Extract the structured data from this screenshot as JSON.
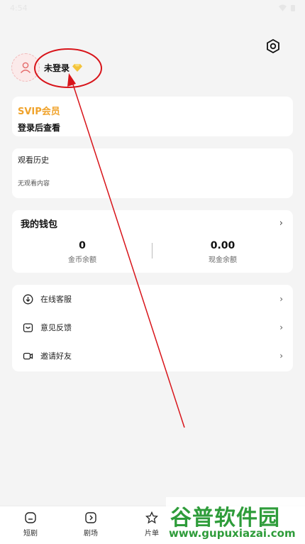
{
  "status_bar": {
    "time": "4:54"
  },
  "profile": {
    "login_text": "未登录"
  },
  "svip": {
    "title": "SVIP会员",
    "subtitle": "登录后查看"
  },
  "history": {
    "title": "观看历史",
    "empty_text": "无观看内容"
  },
  "wallet": {
    "title": "我的钱包",
    "coins_value": "0",
    "coins_label": "金币余额",
    "cash_value": "0.00",
    "cash_label": "现金余额"
  },
  "menu": {
    "items": [
      {
        "label": "在线客服",
        "icon": "download-circle-icon"
      },
      {
        "label": "意见反馈",
        "icon": "message-box-icon"
      },
      {
        "label": "邀请好友",
        "icon": "video-camera-icon"
      }
    ]
  },
  "tabbar": {
    "tabs": [
      {
        "label": "短剧",
        "icon": "home-icon"
      },
      {
        "label": "剧场",
        "icon": "play-square-icon"
      },
      {
        "label": "片单",
        "icon": "star-icon"
      }
    ]
  },
  "watermark": {
    "main": "谷普软件园",
    "url": "www.gupuxiazai.com"
  },
  "colors": {
    "accent_gold": "#f0a32c",
    "annotation_red": "#d8141a",
    "watermark_green": "#2e9c3a"
  }
}
